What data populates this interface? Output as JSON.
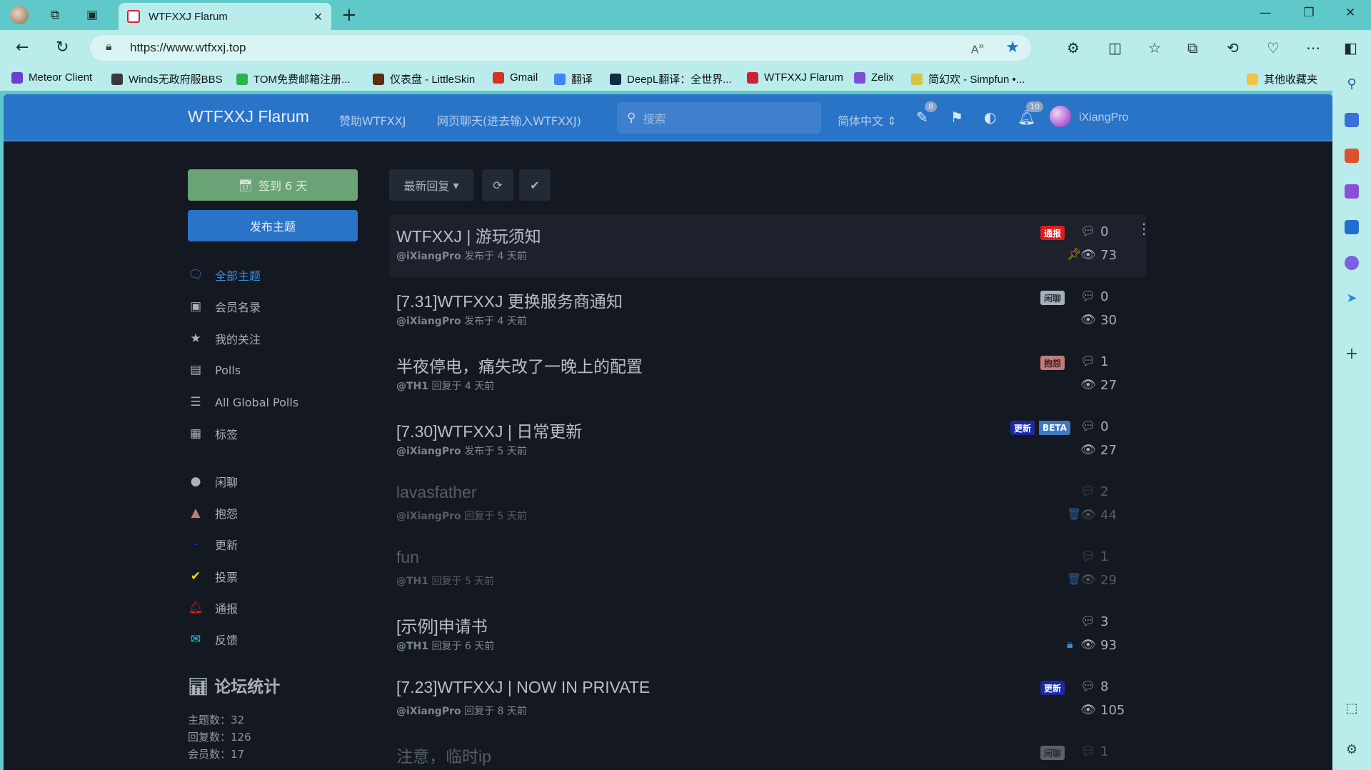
{
  "browser": {
    "tab_title": "WTFXXJ Flarum",
    "url": "https://www.wtfxxj.top",
    "bookmarks": [
      {
        "label": "Meteor Client",
        "color": "#6b3fd1"
      },
      {
        "label": "Winds无政府服BBS",
        "color": "#3a3a3a"
      },
      {
        "label": "TOM免费邮箱注册...",
        "color": "#2bb24c"
      },
      {
        "label": "仪表盘 - LittleSkin",
        "color": "#5a2d14"
      },
      {
        "label": "Gmail",
        "color": "#d93025"
      },
      {
        "label": "翻译",
        "color": "#4285f4"
      },
      {
        "label": "DeepL翻译：全世界...",
        "color": "#0f2b46"
      },
      {
        "label": "WTFXXJ Flarum",
        "color": "#c23"
      },
      {
        "label": "Zelix",
        "color": "#7a4fd8"
      },
      {
        "label": "简幻欢 - Simpfun •...",
        "color": "#d9c24a"
      }
    ],
    "other_bookmarks": "其他收藏夹"
  },
  "header": {
    "brand": "WTFXXJ Flarum",
    "links": [
      "赞助WTFXXJ",
      "网页聊天(进去输入WTFXXJ)"
    ],
    "search_placeholder": "搜索",
    "language": "简体中文",
    "drafts_count": "8",
    "notifications_count": "10",
    "username": "iXiangPro"
  },
  "sidebar": {
    "checkin_label": "签到 6 天",
    "new_discussion_label": "发布主题",
    "nav": [
      {
        "label": "全部主题",
        "icon": "comments-icon",
        "active": true
      },
      {
        "label": "会员名录",
        "icon": "address-book-icon"
      },
      {
        "label": "我的关注",
        "icon": "star-icon"
      },
      {
        "label": "Polls",
        "icon": "poll-icon"
      },
      {
        "label": "All Global Polls",
        "icon": "list-icon"
      },
      {
        "label": "标签",
        "icon": "tags-grid-icon"
      }
    ],
    "tags": [
      {
        "label": "闲聊",
        "icon": "chat-bubble-icon",
        "color": "#a9b0ba"
      },
      {
        "label": "抱怨",
        "icon": "poop-icon",
        "color": "#c27c7c"
      },
      {
        "label": "更新",
        "icon": "dash-icon",
        "color": "#1a2aa0"
      },
      {
        "label": "投票",
        "icon": "check-icon",
        "color": "#f5d90a"
      },
      {
        "label": "通报",
        "icon": "bell-icon",
        "color": "#e01b1b"
      },
      {
        "label": "反馈",
        "icon": "envelope-icon",
        "color": "#13d3e0"
      }
    ],
    "stats_title": "论坛统计",
    "stats": [
      "主题数：32",
      "回复数：126",
      "会员数：17"
    ]
  },
  "toolbar": {
    "sort_label": "最新回复"
  },
  "discussions": [
    {
      "title": "WTFXXJ | 游玩须知",
      "author": "@iXiangPro",
      "action": "发布于 4 天前",
      "tags": [
        {
          "label": "通报",
          "color": "#e01b1b"
        }
      ],
      "replies": "0",
      "views": "73",
      "state_icon": "pin-icon",
      "highlight": true
    },
    {
      "title": "[7.31]WTFXXJ 更换服务商通知",
      "author": "@iXiangPro",
      "action": "发布于 4 天前",
      "tags": [
        {
          "label": "闲聊",
          "color": "#a9b0ba"
        }
      ],
      "replies": "0",
      "views": "30"
    },
    {
      "title": "半夜停电，痛失改了一晚上的配置",
      "author": "@TH1",
      "action": "回复于 4 天前",
      "tags": [
        {
          "label": "抱怨",
          "color": "#c27c7c"
        }
      ],
      "replies": "1",
      "views": "27"
    },
    {
      "title": "[7.30]WTFXXJ | 日常更新",
      "author": "@iXiangPro",
      "action": "发布于 5 天前",
      "tags": [
        {
          "label": "更新",
          "color": "#1a2aa0"
        },
        {
          "label": "BETA",
          "color": "#3e78c4"
        }
      ],
      "replies": "0",
      "views": "27"
    },
    {
      "title": "lavasfather",
      "author": "@iXiangPro",
      "action": "回复于 5 天前",
      "tags": [],
      "replies": "2",
      "views": "44",
      "state_icon": "trash-icon",
      "dim": true
    },
    {
      "title": "fun",
      "author": "@TH1",
      "action": "回复于 5 天前",
      "tags": [],
      "replies": "1",
      "views": "29",
      "state_icon": "trash-icon",
      "dim": true
    },
    {
      "title": "[示例]申请书",
      "author": "@TH1",
      "action": "回复于 6 天前",
      "tags": [],
      "replies": "3",
      "views": "93",
      "state_icon": "lock-icon"
    },
    {
      "title": "[7.23]WTFXXJ | NOW IN PRIVATE",
      "author": "@iXiangPro",
      "action": "回复于 8 天前",
      "tags": [
        {
          "label": "更新",
          "color": "#1a2aa0"
        }
      ],
      "replies": "8",
      "views": "105"
    },
    {
      "title": "注意，临时ip",
      "author": "",
      "action": "",
      "tags": [
        {
          "label": "闲聊",
          "color": "#a9b0ba"
        }
      ],
      "replies": "1",
      "views": "",
      "dim": true
    }
  ]
}
